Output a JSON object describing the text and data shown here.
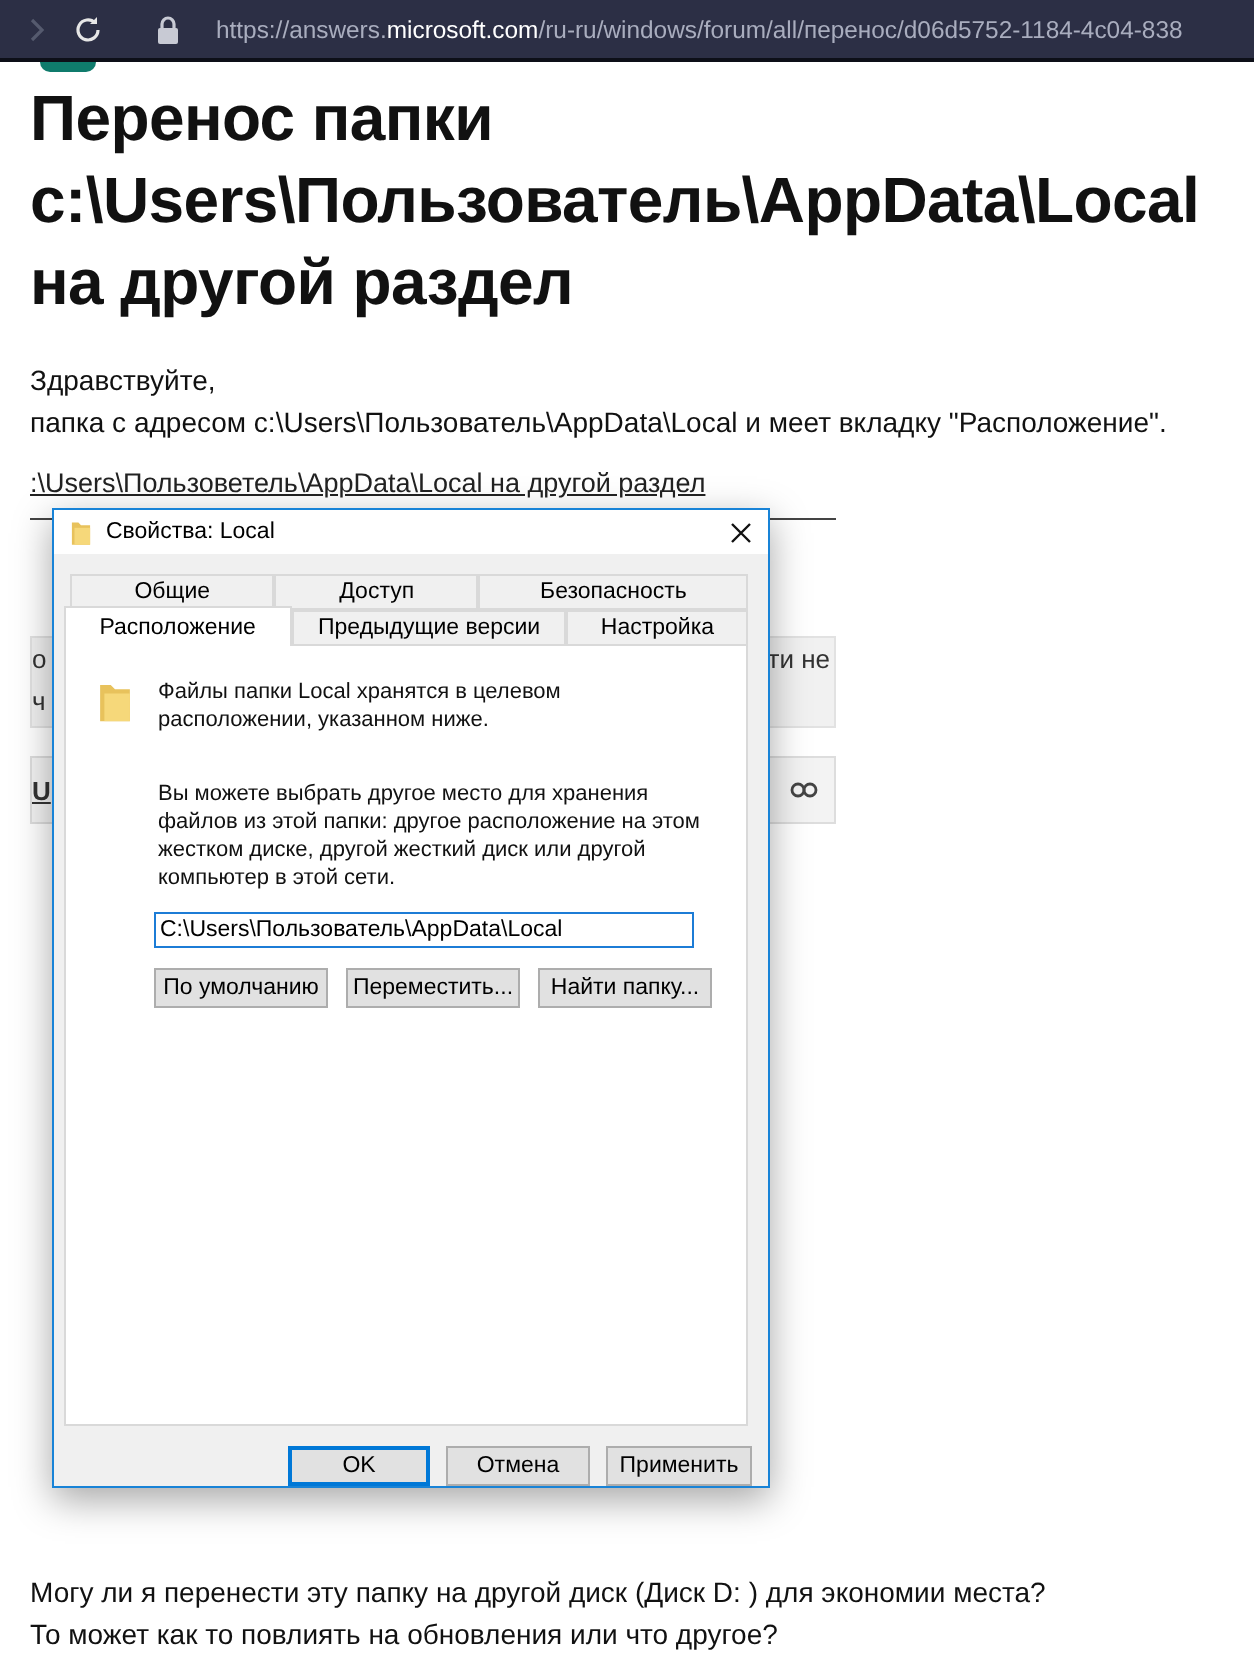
{
  "browser": {
    "url": {
      "prefix": "https://answers.",
      "domain": "microsoft.com",
      "path": "/ru-ru/windows/forum/all/перенос/d06d5752-1184-4c04-838"
    }
  },
  "title": "Перенос папки c:\\Users\\Пользователь\\AppData\\Local на другой раздел",
  "body": [
    "Здравствуйте,",
    "папка с адресом c:\\Users\\Пользователь\\AppData\\Local и меет вкладку \"Расположение\"."
  ],
  "screenshot": {
    "background": {
      "line_text": ":\\Users\\Пользоветель\\AppData\\Local на другой раздел",
      "box_left": [
        "о",
        "ч"
      ],
      "box_right": "ти не",
      "toolbar_letter": "U"
    },
    "dialog": {
      "title": "Свойства: Local",
      "tab_rows": [
        {
          "tabs": [
            {
              "label": "Общие",
              "selected": false
            },
            {
              "label": "Доступ",
              "selected": false
            },
            {
              "label": "Безопасность",
              "selected": false
            }
          ]
        },
        {
          "tabs": [
            {
              "label": "Расположение",
              "selected": true
            },
            {
              "label": "Предыдущие версии",
              "selected": false
            },
            {
              "label": "Настройка",
              "selected": false
            }
          ]
        }
      ],
      "info": "Файлы папки Local хранятся в целевом расположении, указанном ниже.",
      "description": "Вы можете выбрать другое место для хранения файлов из этой папки: другое расположение на этом жестком диске, другой жесткий диск или другой компьютер в этой сети.",
      "path_value": "C:\\Users\\Пользователь\\AppData\\Local",
      "buttons": [
        "По умолчанию",
        "Переместить...",
        "Найти папку..."
      ],
      "footer_buttons": [
        {
          "label": "OK",
          "default": true
        },
        {
          "label": "Отмена",
          "default": false
        },
        {
          "label": "Применить",
          "default": false
        }
      ]
    }
  },
  "question": [
    "Могу ли я перенести эту папку на другой диск (Диск D: ) для экономии места?",
    "То может как то повлиять на обновления или что другое?"
  ]
}
